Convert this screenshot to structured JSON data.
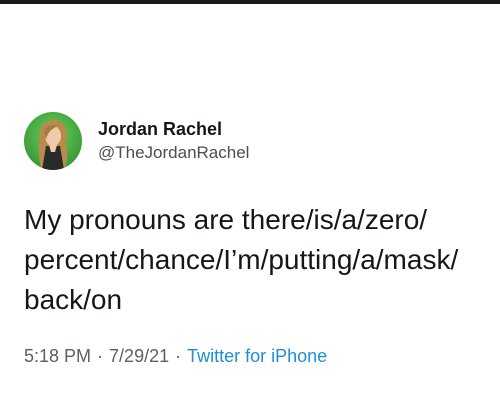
{
  "tweet": {
    "author": {
      "display_name": "Jordan Rachel",
      "handle": "@TheJordanRachel",
      "avatar_icon": "profile-photo"
    },
    "text": "My pronouns are there/is/a/zero/\npercent/chance/I’m/putting/a/mask/\nback/on",
    "time": "5:18 PM",
    "separator": "·",
    "date": "7/29/21",
    "source": "Twitter for iPhone"
  },
  "colors": {
    "text": "#14171a",
    "secondary": "#5b6066",
    "link": "#1d8fd6",
    "avatar_bg": "#3fae3a"
  }
}
